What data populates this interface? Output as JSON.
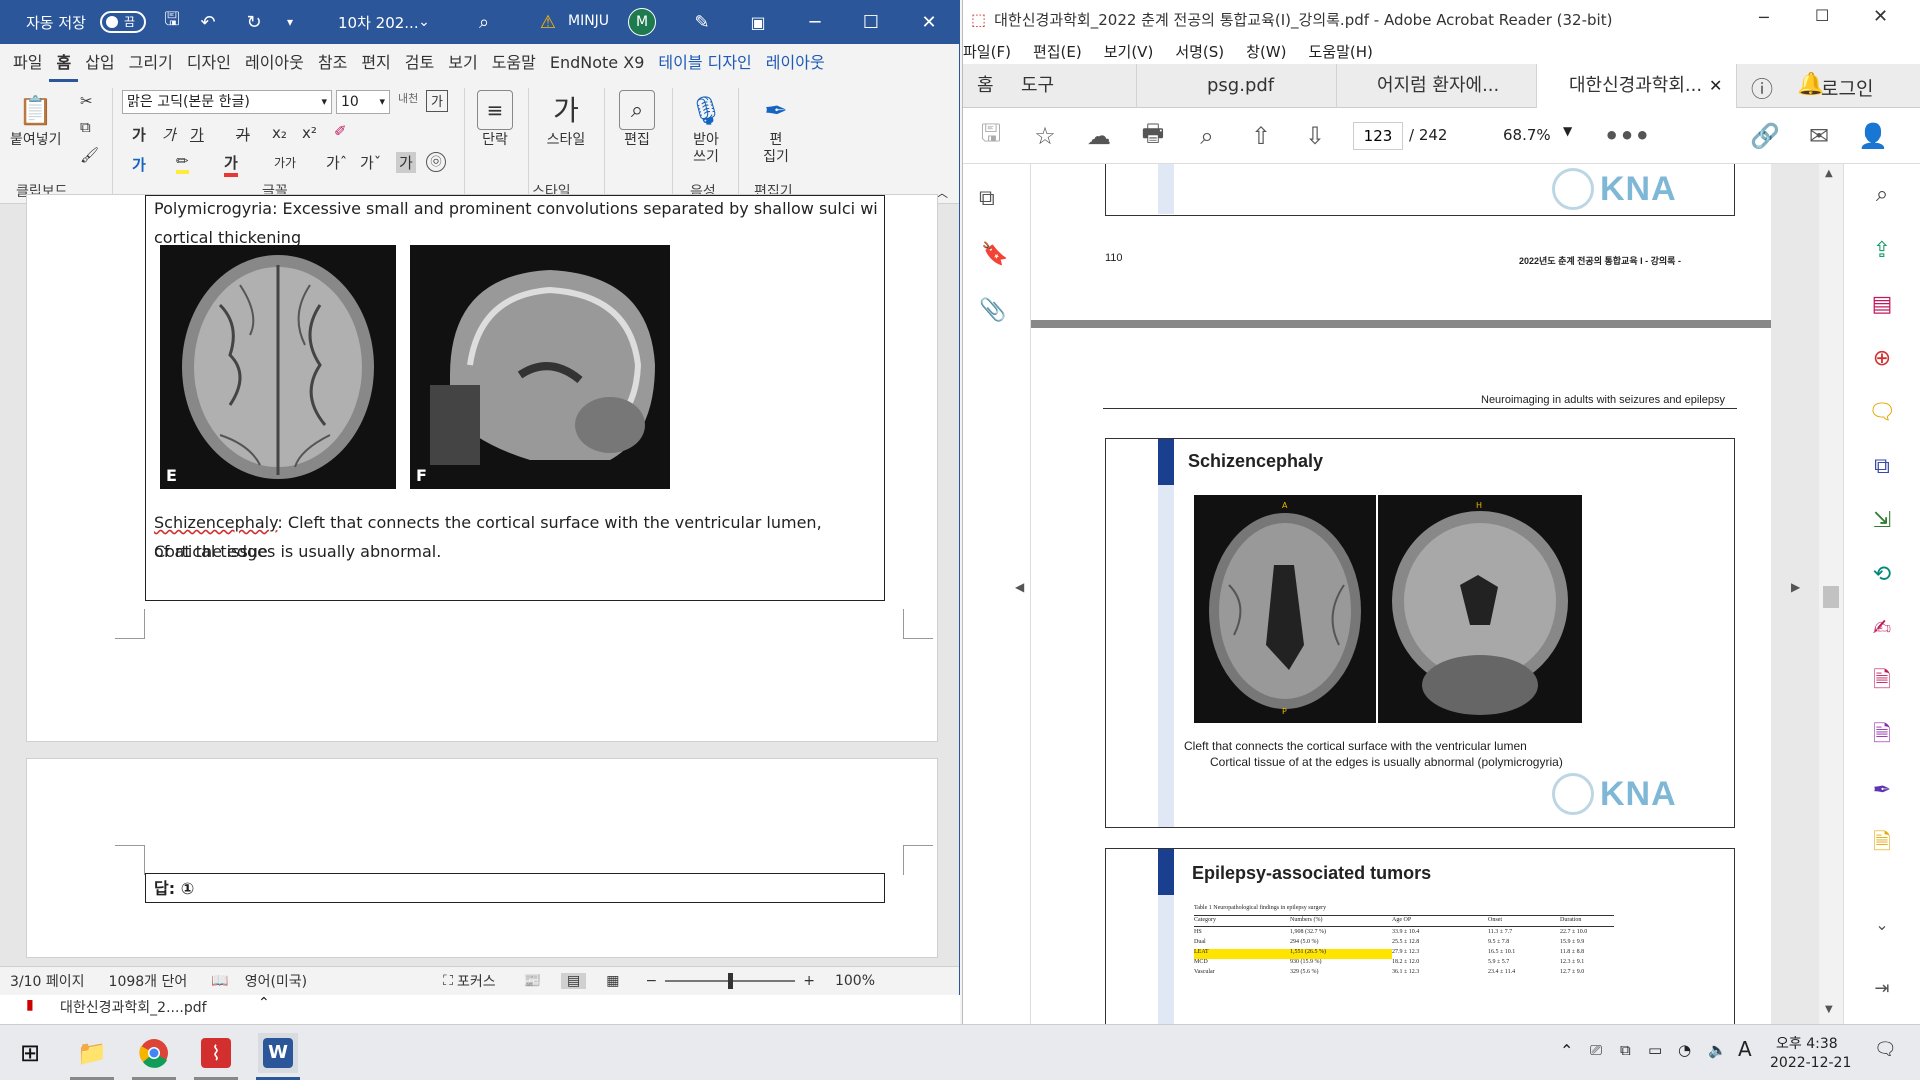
{
  "word": {
    "title": {
      "autosave_label": "자동 저장",
      "autosave_state": "끔",
      "doc_name": "10차 202...",
      "user_name": "MINJU",
      "user_initial": "M"
    },
    "tabs": [
      "파일",
      "홈",
      "삽입",
      "그리기",
      "디자인",
      "레이아웃",
      "참조",
      "편지",
      "검토",
      "보기",
      "도움말",
      "EndNote X9",
      "테이블 디자인",
      "레이아웃"
    ],
    "ribbon": {
      "paste_label": "붙여넣기",
      "font_name": "맑은 고딕(본문 한글)",
      "font_size": "10",
      "paragraph_label": "단락",
      "styles_label": "스타일",
      "edit_label": "편집",
      "dictate_label": "받아\n쓰기",
      "editor_label": "편\n집기",
      "groups": {
        "clipboard": "클립보드",
        "font": "글꼴",
        "style": "스타일",
        "voice": "음성",
        "editor": "편집기"
      }
    },
    "doc": {
      "line1": "Polymicrogyria: Excessive small and prominent convolutions separated by shallow sulci with focal",
      "line2": "cortical thickening",
      "img_e_label": "E",
      "img_f_label": "F",
      "schiz_word": "Schizencephaly",
      "schiz_text": ": Cleft that connects the cortical surface with the ventricular lumen, Cortical tissue",
      "schiz_text2": "of at the edges is usually abnormal.",
      "answer_label": "답: ①"
    },
    "status": {
      "page": "3/10 페이지",
      "words": "1098개 단어",
      "language": "영어(미국)",
      "focus": "포커스",
      "zoom": "100%"
    },
    "download_name": "대한신경과학회_2....pdf"
  },
  "acrobat": {
    "title": "대한신경과학회_2022 춘계 전공의 통합교육(I)_강의록.pdf - Adobe Acrobat Reader (32-bit)",
    "menu": [
      "파일(F)",
      "편집(E)",
      "보기(V)",
      "서명(S)",
      "창(W)",
      "도움말(H)"
    ],
    "tabs": {
      "home": "홈",
      "tools": "도구",
      "doc1": "psg.pdf",
      "doc2": "어지럼 환자에...",
      "doc3": "대한신경과학회..."
    },
    "login": "로그인",
    "page_current": "123",
    "page_total": "/ 242",
    "zoom": "68.7%",
    "page110_num": "110",
    "page110_header": "2022년도 춘계 전공의 통합교육 I  - 강의록 -",
    "page_header2": "Neuroimaging in adults with seizures and epilepsy",
    "kna": "KNA",
    "slide1": {
      "title": "Schizencephaly",
      "label_a": "A",
      "label_h": "H",
      "label_p": "P",
      "cap1": "Cleft that connects the cortical surface with the ventricular lumen",
      "cap2": "Cortical tissue of at the edges is usually abnormal (polymicrogyria)"
    },
    "slide2": {
      "title": "Epilepsy-associated tumors",
      "table_caption": "Table 1  Neuropathological findings in epilepsy surgery",
      "headers": [
        "Category",
        "Numbers (%)",
        "Age OP",
        "Onset",
        "Duration"
      ],
      "rows": [
        [
          "HS",
          "1,908 (32.7 %)",
          "33.9 ± 10.4",
          "11.3 ± 7.7",
          "22.7 ± 10.0"
        ],
        [
          "Dual",
          "294 (5.0 %)",
          "25.5 ± 12.8",
          "9.5 ± 7.8",
          "15.9 ± 9.9"
        ],
        [
          "LEAT",
          "1,551 (26.5 %)",
          "27.9 ± 12.3",
          "16.5 ± 10.1",
          "11.8 ± 8.8"
        ],
        [
          "MCD",
          "930 (15.9 %)",
          "18.2 ± 12.0",
          "5.9 ± 5.7",
          "12.3 ± 9.1"
        ],
        [
          "Vascular",
          "329 (5.6 %)",
          "36.1 ± 12.3",
          "23.4 ± 11.4",
          "12.7 ± 9.0"
        ]
      ]
    }
  },
  "taskbar": {
    "time": "오후 4:38",
    "date": "2022-12-21",
    "ime": "A"
  }
}
